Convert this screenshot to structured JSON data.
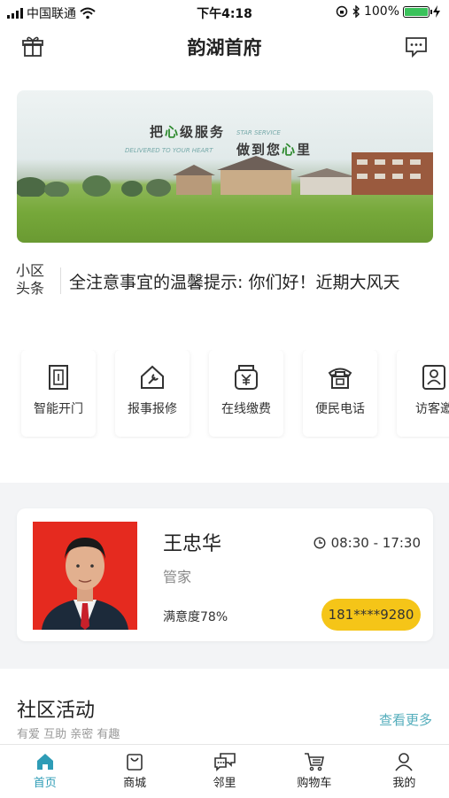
{
  "status_bar": {
    "carrier": "中国联通",
    "time": "下午4:18",
    "battery": "100%",
    "battery_level": 1.0
  },
  "header": {
    "title": "韵湖首府",
    "left_icon": "gift-icon",
    "right_icon": "message-icon"
  },
  "banner": {
    "slogan_1_prefix": "把",
    "slogan_1_heart": "心",
    "slogan_1_suffix": "级服务",
    "slogan_en_1": "STAR SERVICE",
    "slogan_en_2": "DELIVERED TO YOUR HEART",
    "slogan_2_prefix": "做到您",
    "slogan_2_heart": "心",
    "slogan_2_suffix": "里"
  },
  "news": {
    "label": "小区头条",
    "text": "全注意事宜的温馨提示: 你们好！近期大风天"
  },
  "services": [
    {
      "label": "智能开门",
      "icon": "door-icon"
    },
    {
      "label": "报事报修",
      "icon": "repair-icon"
    },
    {
      "label": "在线缴费",
      "icon": "payment-icon"
    },
    {
      "label": "便民电话",
      "icon": "telephone-icon"
    },
    {
      "label": "访客邀",
      "icon": "visitor-icon"
    }
  ],
  "steward": {
    "name": "王忠华",
    "role": "管家",
    "hours": "08:30 - 17:30",
    "satisfaction": "满意度78%",
    "phone": "181****9280"
  },
  "activity": {
    "title": "社区活动",
    "subtitle": "有爱 互助 亲密 有趣",
    "more": "查看更多"
  },
  "tabs": [
    {
      "label": "首页",
      "icon": "home-icon",
      "active": true
    },
    {
      "label": "商城",
      "icon": "shopping-bag-icon",
      "active": false
    },
    {
      "label": "邻里",
      "icon": "chat-icon",
      "active": false
    },
    {
      "label": "购物车",
      "icon": "cart-icon",
      "active": false
    },
    {
      "label": "我的",
      "icon": "user-icon",
      "active": false
    }
  ],
  "colors": {
    "accent": "#2e9cb6",
    "phone_pill": "#f5c518",
    "more_link": "#55aebc"
  }
}
